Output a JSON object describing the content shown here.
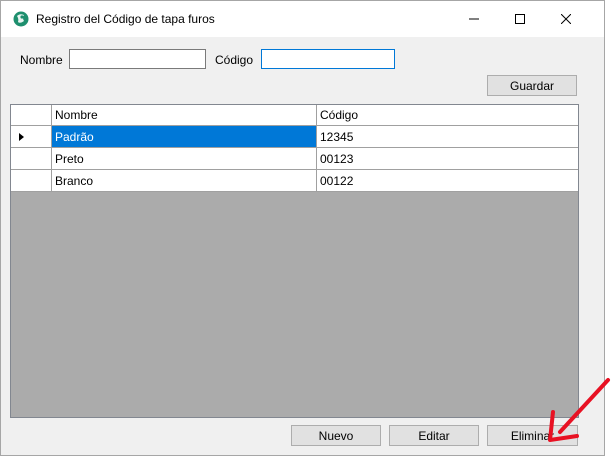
{
  "window": {
    "title": "Registro del Código de tapa furos",
    "controls": [
      "minimize-icon",
      "maximize-icon",
      "close-icon"
    ]
  },
  "form": {
    "nombre_label": "Nombre",
    "nombre_value": "",
    "codigo_label": "Código",
    "codigo_value": "",
    "guardar_label": "Guardar"
  },
  "grid": {
    "columns": [
      "Nombre",
      "Código"
    ],
    "rows": [
      {
        "nombre": "Padrão",
        "codigo": "12345",
        "selected": true,
        "current": true
      },
      {
        "nombre": "Preto",
        "codigo": "00123",
        "selected": false,
        "current": false
      },
      {
        "nombre": "Branco",
        "codigo": "00122",
        "selected": false,
        "current": false
      }
    ]
  },
  "actions": {
    "nuevo_label": "Nuevo",
    "editar_label": "Editar",
    "eliminar_label": "Eliminar"
  },
  "annotation": {
    "pointer": "red-arrow-icon",
    "color": "#e81123"
  },
  "colors": {
    "selection": "#0078d7",
    "grid_background": "#ababab",
    "window_background": "#f0f0f0"
  }
}
